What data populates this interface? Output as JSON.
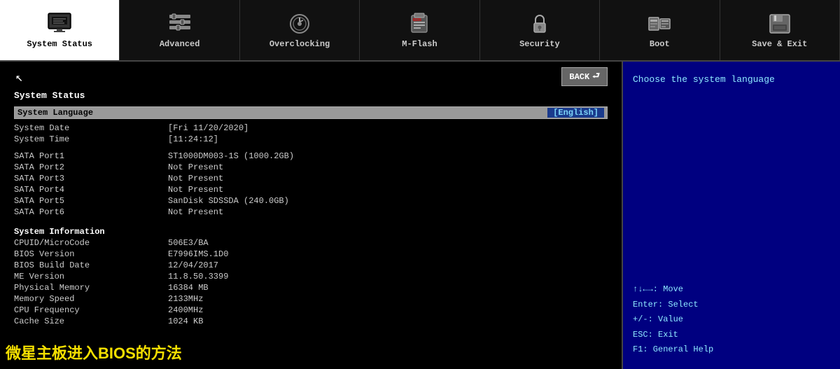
{
  "nav": {
    "items": [
      {
        "id": "system-status",
        "label": "System Status",
        "active": true
      },
      {
        "id": "advanced",
        "label": "Advanced",
        "active": false
      },
      {
        "id": "overclocking",
        "label": "Overclocking",
        "active": false
      },
      {
        "id": "m-flash",
        "label": "M-Flash",
        "active": false
      },
      {
        "id": "security",
        "label": "Security",
        "active": false
      },
      {
        "id": "boot",
        "label": "Boot",
        "active": false
      },
      {
        "id": "save-exit",
        "label": "Save & Exit",
        "active": false
      }
    ]
  },
  "left": {
    "section_title": "System Status",
    "back_label": "BACK",
    "system_language_label": "System Language",
    "system_language_value": "[English]",
    "rows": [
      {
        "label": "System Date",
        "value": "[Fri 11/20/2020]"
      },
      {
        "label": "System Time",
        "value": "[11:24:12]"
      }
    ],
    "sata": [
      {
        "label": "SATA Port1",
        "value": "ST1000DM003-1S (1000.2GB)"
      },
      {
        "label": "SATA Port2",
        "value": "Not Present"
      },
      {
        "label": "SATA Port3",
        "value": "Not Present"
      },
      {
        "label": "SATA Port4",
        "value": "Not Present"
      },
      {
        "label": "SATA Port5",
        "value": "SanDisk SDSSDA (240.0GB)"
      },
      {
        "label": "SATA Port6",
        "value": "Not Present"
      }
    ],
    "system_info_title": "System Information",
    "system_info": [
      {
        "label": "CPUID/MicroCode",
        "value": "506E3/BA"
      },
      {
        "label": "BIOS Version",
        "value": "E7996IMS.1D0"
      },
      {
        "label": "BIOS Build Date",
        "value": "12/04/2017"
      },
      {
        "label": "ME Version",
        "value": "11.8.50.3399"
      },
      {
        "label": "Physical Memory",
        "value": "16384 MB"
      },
      {
        "label": "Memory Speed",
        "value": "2133MHz"
      },
      {
        "label": "CPU Frequency",
        "value": "2400MHz"
      },
      {
        "label": "Cache Size",
        "value": "1024 KB"
      }
    ]
  },
  "right": {
    "help_text": "Choose the system language",
    "key_hints": [
      "↑↓←→: Move",
      "Enter: Select",
      "+/-: Value",
      "ESC: Exit",
      "F1: General Help"
    ]
  },
  "watermark": "微星主板进入BIOS的方法"
}
